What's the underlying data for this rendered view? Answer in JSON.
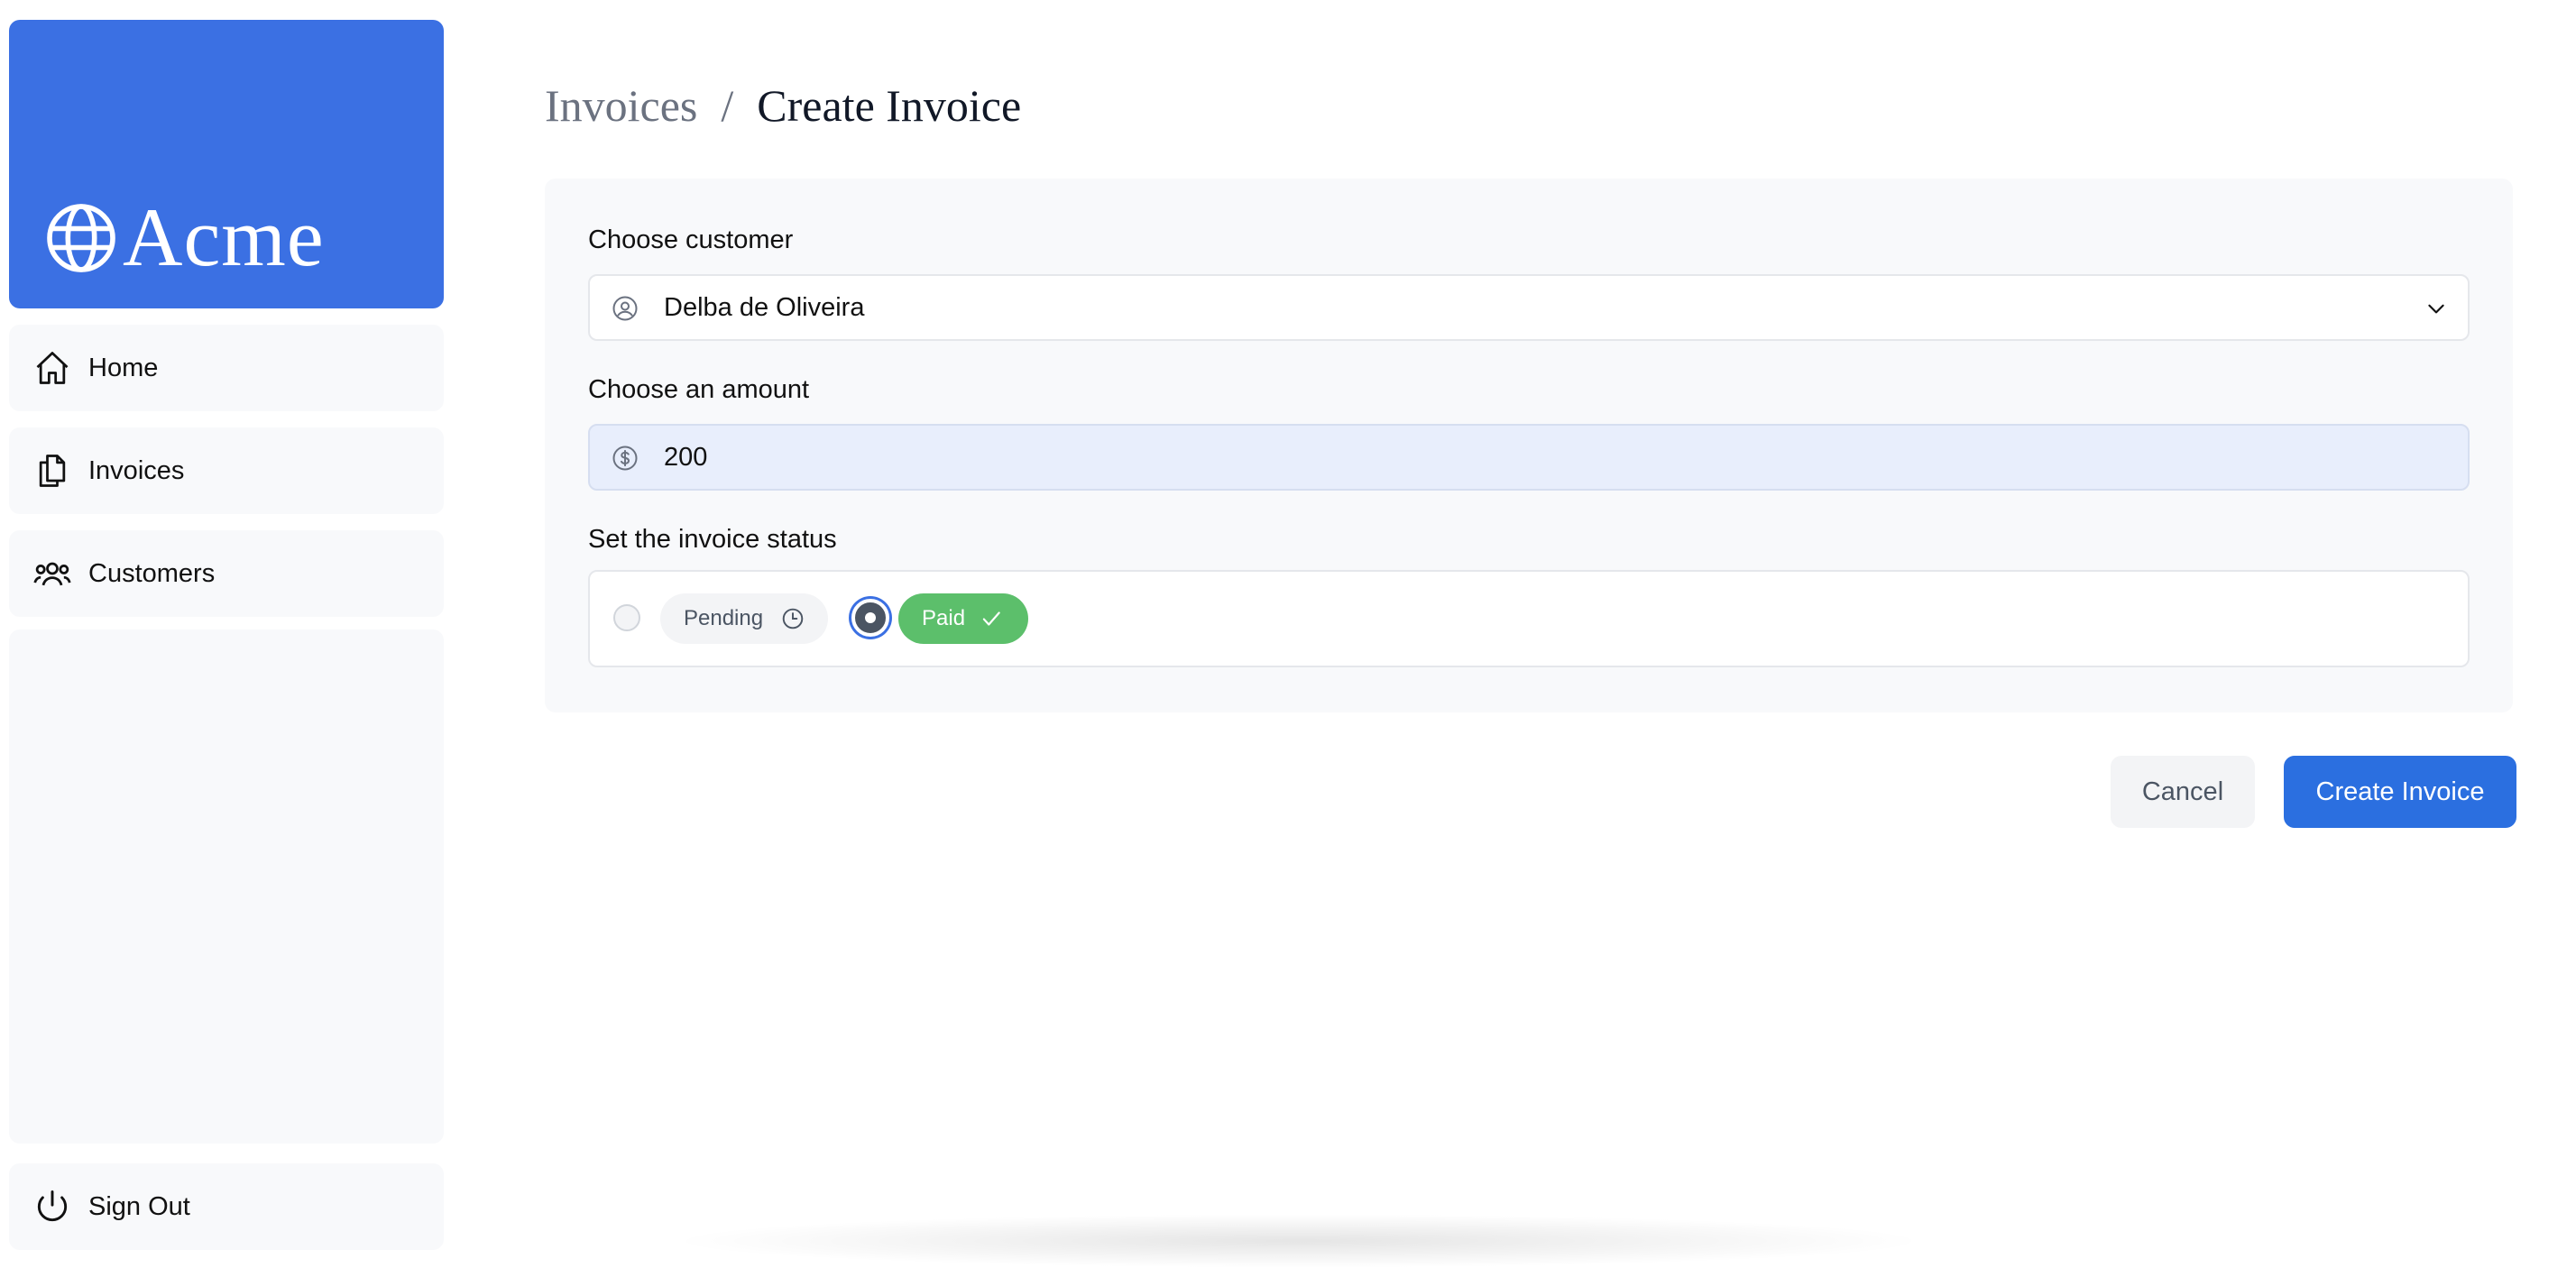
{
  "sidebar": {
    "brand": "Acme",
    "items": [
      {
        "label": "Home",
        "icon": "home-icon"
      },
      {
        "label": "Invoices",
        "icon": "documents-icon"
      },
      {
        "label": "Customers",
        "icon": "users-icon"
      }
    ],
    "sign_out": "Sign Out"
  },
  "breadcrumb": {
    "parent": "Invoices",
    "separator": "/",
    "current": "Create Invoice"
  },
  "form": {
    "customer": {
      "label": "Choose customer",
      "value": "Delba de Oliveira",
      "icon": "user-circle-icon"
    },
    "amount": {
      "label": "Choose an amount",
      "value": "200",
      "icon": "dollar-circle-icon"
    },
    "status": {
      "label": "Set the invoice status",
      "options": [
        {
          "label": "Pending",
          "icon": "clock-icon",
          "selected": false
        },
        {
          "label": "Paid",
          "icon": "check-icon",
          "selected": true
        }
      ]
    }
  },
  "actions": {
    "cancel": "Cancel",
    "submit": "Create Invoice"
  },
  "colors": {
    "brand": "#3b70e3",
    "primary_button": "#2b6fe0",
    "paid": "#5cbf6b"
  }
}
